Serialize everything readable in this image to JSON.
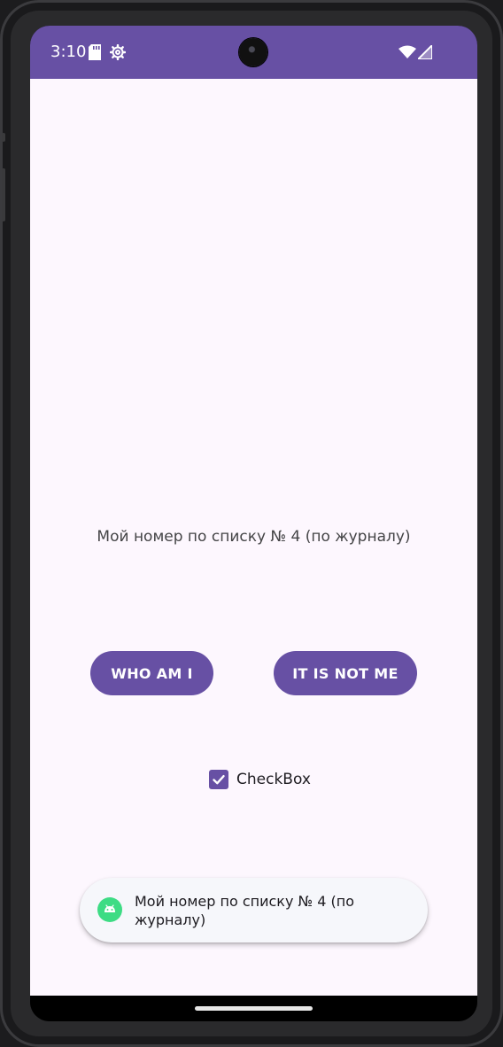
{
  "status_bar": {
    "time": "3:10",
    "icons": [
      "sd-card-icon",
      "settings-gear-icon",
      "wifi-icon",
      "signal-icon"
    ],
    "color": "#6750a4"
  },
  "main": {
    "label_text": "Мой номер по списку № 4 (по журналу)",
    "buttons": {
      "who_am_i": "WHO AM I",
      "it_is_not_me": "IT IS NOT ME"
    },
    "checkbox": {
      "label": "CheckBox",
      "checked": true
    }
  },
  "toast": {
    "text": "Мой номер по списку № 4 (по журналу)",
    "icon": "android-icon"
  },
  "colors": {
    "primary": "#6750a4",
    "background": "#fdf7fe",
    "toast_background": "#f6f7fb"
  }
}
